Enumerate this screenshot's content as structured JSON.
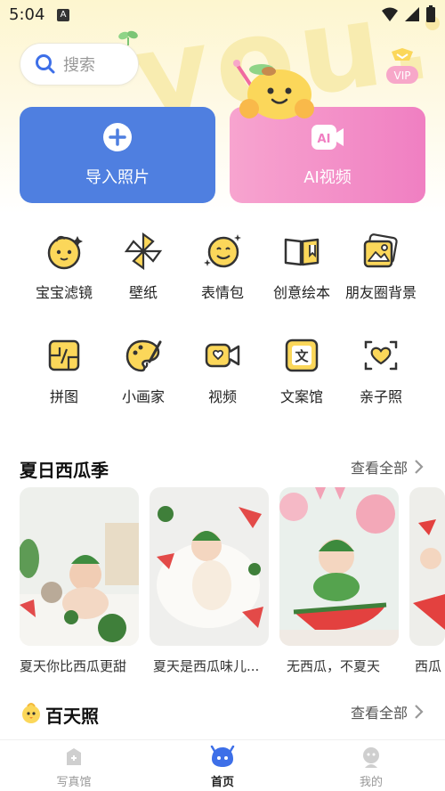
{
  "status_bar": {
    "time": "5:04",
    "notification_letter": "A"
  },
  "search": {
    "placeholder": "搜索"
  },
  "vip_badge": "VIP",
  "actions": [
    {
      "label": "导入照片",
      "icon": "plus-circle-icon"
    },
    {
      "label": "AI视频",
      "icon": "ai-video-icon",
      "icon_text": "AI"
    }
  ],
  "features_row1": [
    {
      "label": "宝宝滤镜",
      "icon": "baby-face-icon"
    },
    {
      "label": "壁纸",
      "icon": "pinwheel-icon"
    },
    {
      "label": "表情包",
      "icon": "smiley-icon"
    },
    {
      "label": "创意绘本",
      "icon": "book-icon"
    },
    {
      "label": "朋友圈背景",
      "icon": "photo-icon"
    }
  ],
  "features_row2": [
    {
      "label": "拼图",
      "icon": "puzzle-icon"
    },
    {
      "label": "小画家",
      "icon": "palette-icon"
    },
    {
      "label": "视频",
      "icon": "video-icon"
    },
    {
      "label": "文案馆",
      "icon": "text-icon",
      "icon_text": "文"
    },
    {
      "label": "亲子照",
      "icon": "heart-frame-icon"
    }
  ],
  "section_summer": {
    "title": "夏日西瓜季",
    "see_all": "查看全部",
    "items": [
      {
        "caption": "夏天你比西瓜更甜"
      },
      {
        "caption": "夏天是西瓜味儿..."
      },
      {
        "caption": "无西瓜，不夏天"
      },
      {
        "caption": "西瓜"
      }
    ]
  },
  "section_hundred": {
    "title": "百天照",
    "see_all": "查看全部"
  },
  "bottom_nav": [
    {
      "label": "写真馆",
      "icon": "studio-icon",
      "active": false
    },
    {
      "label": "首页",
      "icon": "home-face-icon",
      "active": true
    },
    {
      "label": "我的",
      "icon": "profile-icon",
      "active": false
    }
  ],
  "colors": {
    "primary_blue": "#4f7fe0",
    "ai_pink": "#f07fc2",
    "icon_yellow": "#fbd75a",
    "nav_active": "#3d6fe8",
    "nav_inactive": "#999999"
  }
}
